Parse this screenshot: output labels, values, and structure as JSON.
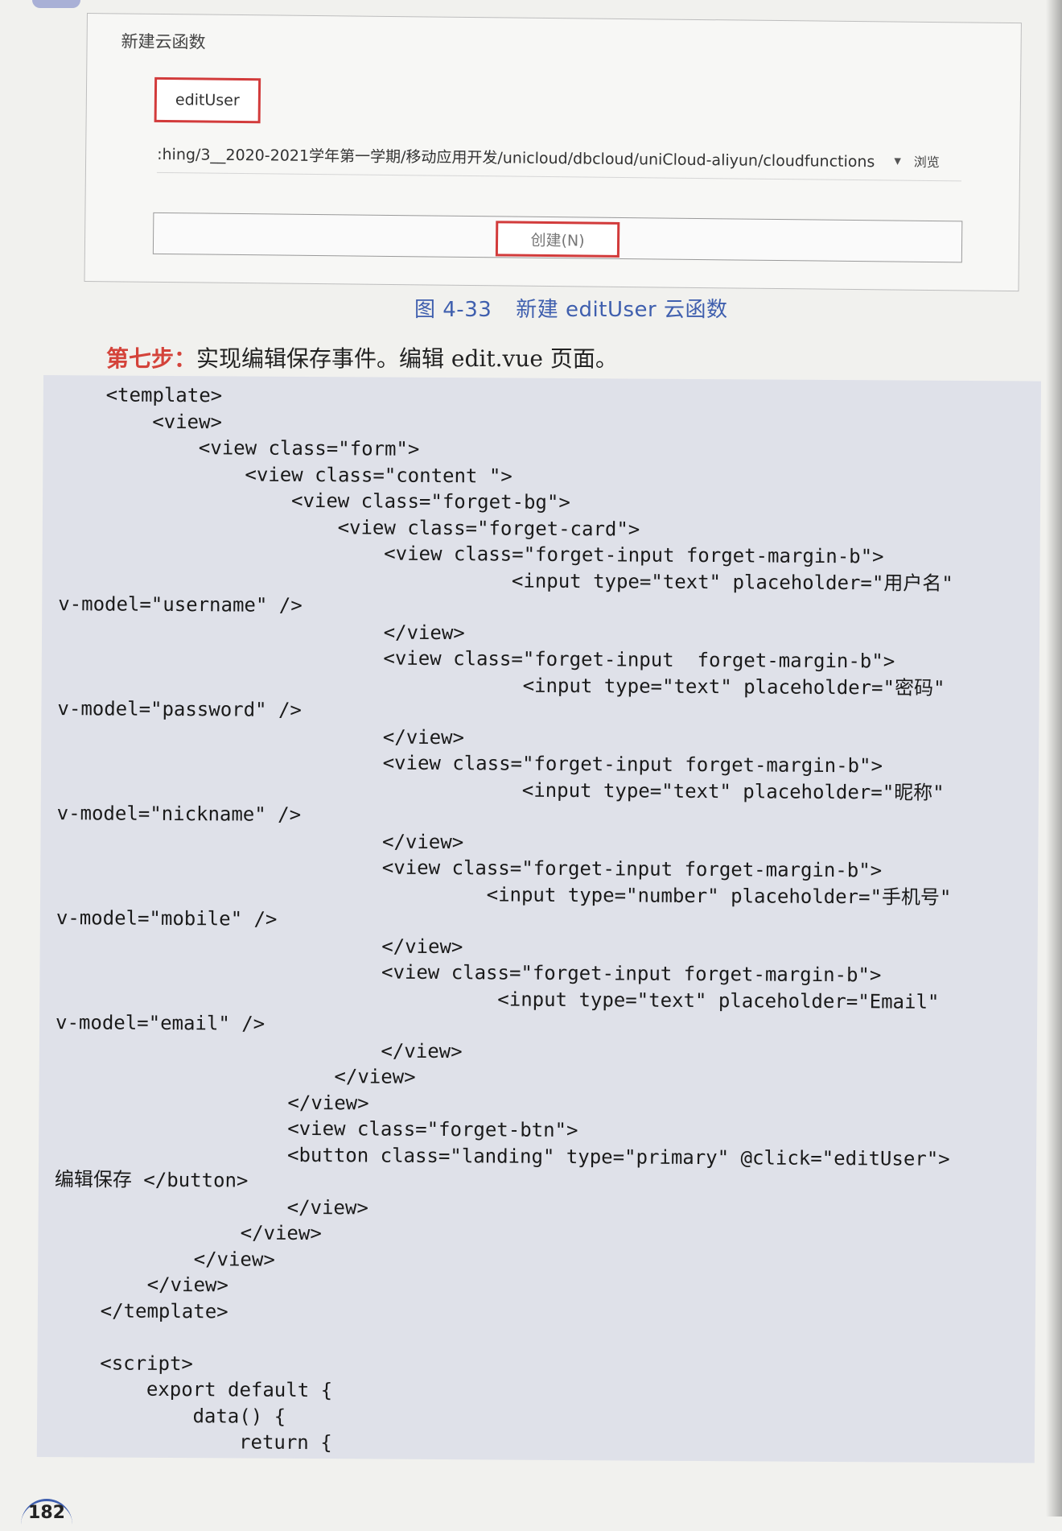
{
  "figure": {
    "dialog_title": "新建云函数",
    "function_name_value": "editUser",
    "path_value": ":hing/3__2020-2021学年第一学期/移动应用开发/unicloud/dbcloud/uniCloud-aliyun/cloudfunctions",
    "dropdown_icon": "chevron-down-icon",
    "browse_label": "浏览",
    "create_button_label": "创建(N)",
    "highlight_color": "#d23b3b"
  },
  "caption": {
    "number": "图 4-33",
    "text": "新建 editUser 云函数",
    "color": "#3f5fae"
  },
  "step": {
    "label": "第七步：",
    "text": "实现编辑保存事件。编辑 edit.vue 页面。",
    "label_color": "#d4433a"
  },
  "code_lines": [
    "    <template>",
    "        <view>",
    "            <view class=\"form\">",
    "                <view class=\"content \">",
    "                    <view class=\"forget-bg\">",
    "                        <view class=\"forget-card\">",
    "                            <view class=\"forget-input forget-margin-b\">",
    "                                       <input type=\"text\" placeholder=\"用户名\"",
    "v-model=\"username\" />",
    "                            </view>",
    "                            <view class=\"forget-input  forget-margin-b\">",
    "                                        <input type=\"text\" placeholder=\"密码\"",
    "v-model=\"password\" />",
    "                            </view>",
    "                            <view class=\"forget-input forget-margin-b\">",
    "                                        <input type=\"text\" placeholder=\"昵称\"",
    "v-model=\"nickname\" />",
    "                            </view>",
    "                            <view class=\"forget-input forget-margin-b\">",
    "                                     <input type=\"number\" placeholder=\"手机号\"",
    "v-model=\"mobile\" />",
    "                            </view>",
    "                            <view class=\"forget-input forget-margin-b\">",
    "                                      <input type=\"text\" placeholder=\"Email\"",
    "v-model=\"email\" />",
    "                            </view>",
    "                        </view>",
    "                    </view>",
    "                    <view class=\"forget-btn\">",
    "                    <button class=\"landing\" type=\"primary\" @click=\"editUser\">",
    "编辑保存 </button>",
    "                    </view>",
    "                </view>",
    "            </view>",
    "        </view>",
    "    </template>",
    "",
    "    <script>",
    "        export default {",
    "            data() {",
    "                return {"
  ],
  "page_number": "182"
}
